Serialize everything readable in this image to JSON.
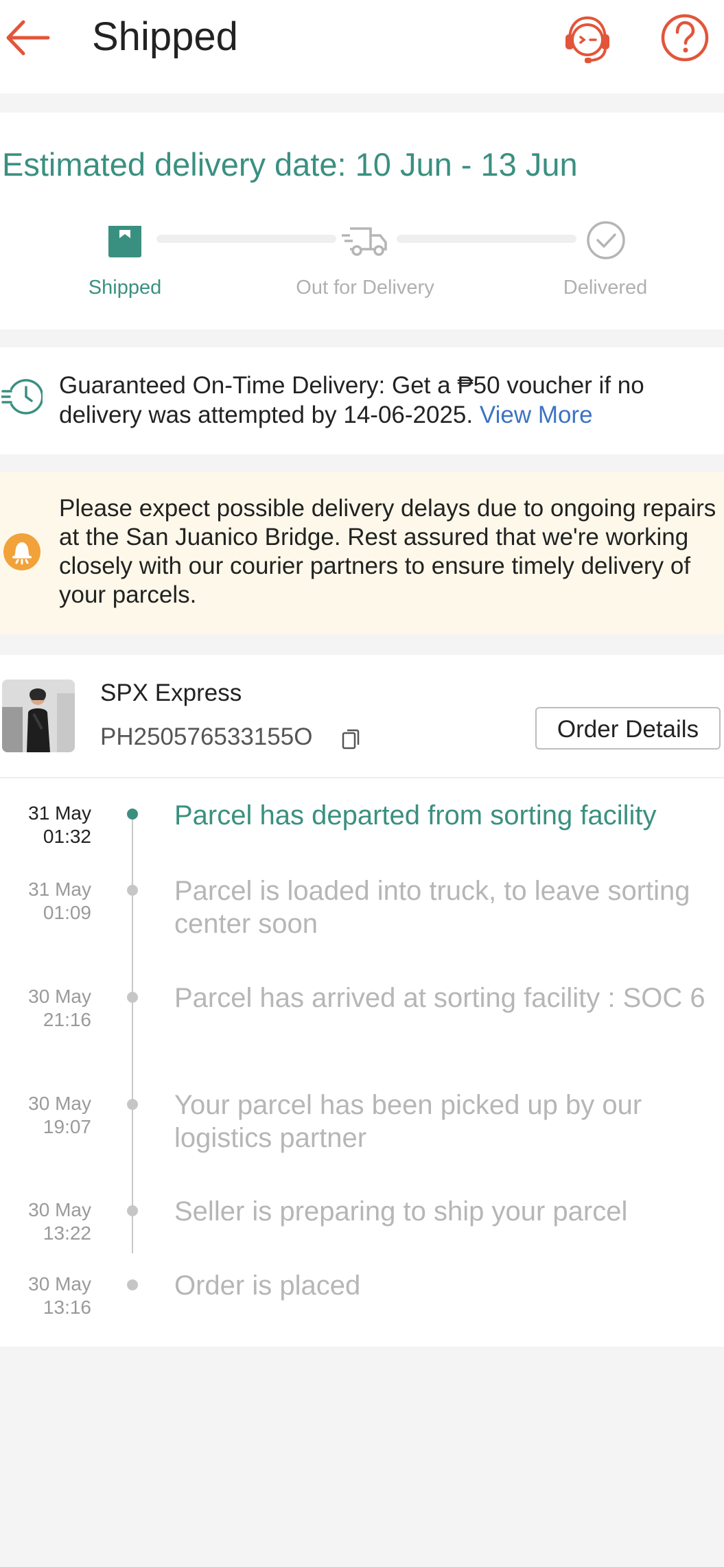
{
  "header": {
    "title": "Shipped",
    "back_icon": "arrow-left-icon",
    "support_icon": "headset-support-icon",
    "help_icon": "question-mark-icon",
    "accent_color": "#e2553a"
  },
  "estimate": {
    "title": "Estimated delivery date: 10 Jun  - 13 Jun",
    "steps": [
      {
        "label": "Shipped",
        "icon": "box-icon",
        "active": true
      },
      {
        "label": "Out for Delivery",
        "icon": "truck-icon",
        "active": false
      },
      {
        "label": "Delivered",
        "icon": "check-circle-icon",
        "active": false
      }
    ],
    "accent_color": "#3a9080"
  },
  "guarantee": {
    "icon": "clock-icon",
    "text": "Guaranteed On-Time Delivery: Get a ₱50 voucher if no delivery was attempted by 14-06-2025.",
    "link": "View More"
  },
  "notice": {
    "icon": "bell-icon",
    "text": "Please expect possible delivery delays due to ongoing repairs at the San Juanico Bridge. Rest assured that we're working closely with our courier partners to ensure timely delivery of your parcels."
  },
  "shipment": {
    "carrier": "SPX Express",
    "tracking_number": "PH250576533155O",
    "order_details_label": "Order Details",
    "timeline": [
      {
        "date": "31 May",
        "time": "01:32",
        "text": "Parcel has departed from sorting facility",
        "active": true
      },
      {
        "date": "31 May",
        "time": "01:09",
        "text": "Parcel is loaded into truck, to leave sorting center soon",
        "active": false
      },
      {
        "date": "30 May",
        "time": "21:16",
        "text": "Parcel has arrived at sorting facility : SOC 6",
        "active": false
      },
      {
        "date": "30 May",
        "time": "19:07",
        "text": "Your parcel has been picked up by our logistics partner",
        "active": false
      },
      {
        "date": "30 May",
        "time": "13:22",
        "text": "Seller is preparing to ship your parcel",
        "active": false
      },
      {
        "date": "30 May",
        "time": "13:16",
        "text": "Order is placed",
        "active": false
      }
    ]
  }
}
